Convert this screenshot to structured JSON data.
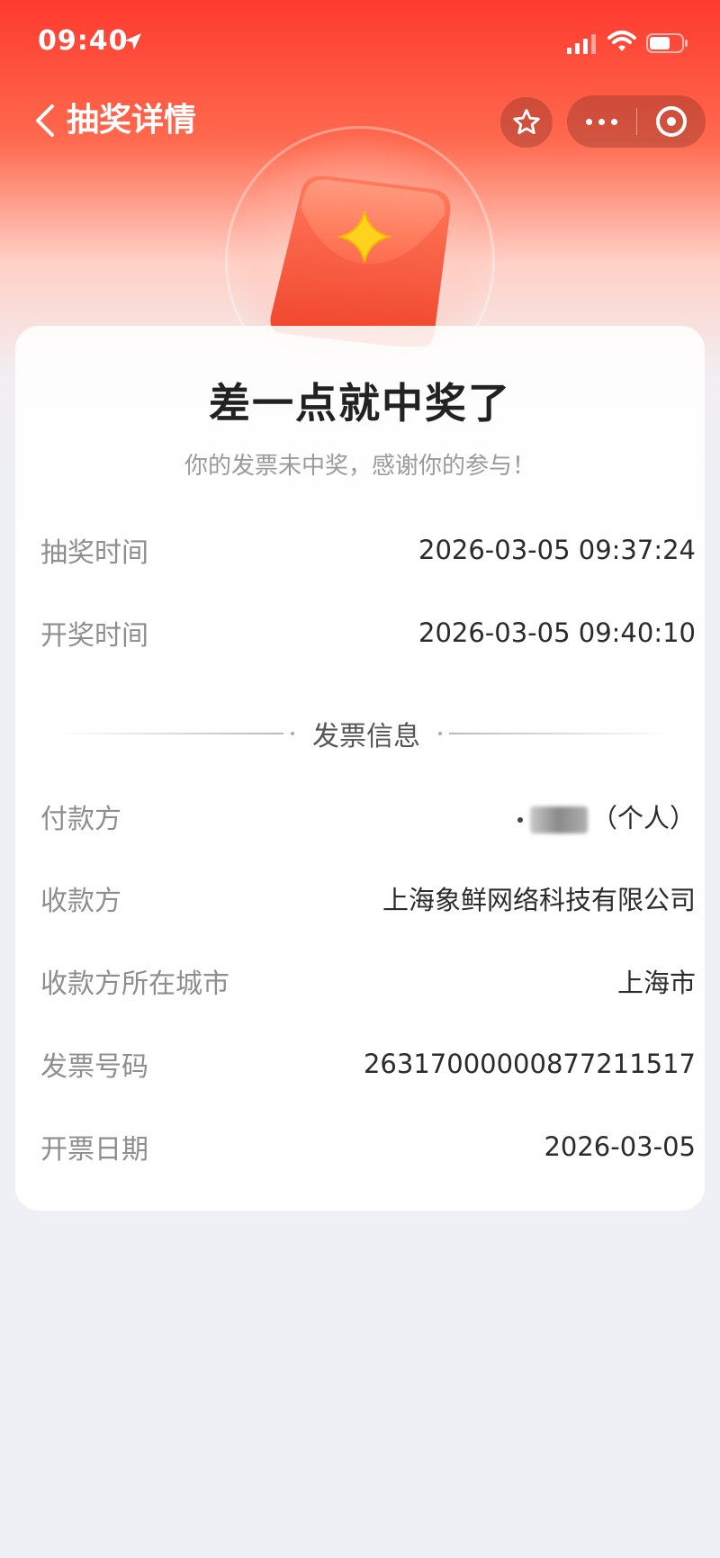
{
  "status_bar": {
    "time": "09:40"
  },
  "nav": {
    "title": "抽奖详情"
  },
  "result": {
    "title": "差一点就中奖了",
    "subtitle": "你的发票未中奖，感谢你的参与！"
  },
  "draw_info": [
    {
      "label": "抽奖时间",
      "value": "2026-03-05 09:37:24"
    },
    {
      "label": "开奖时间",
      "value": "2026-03-05 09:40:10"
    }
  ],
  "invoice_section": {
    "title": "发票信息"
  },
  "invoice_info": [
    {
      "label": "付款方",
      "value": "（个人）"
    },
    {
      "label": "收款方",
      "value": "上海象鲜网络科技有限公司"
    },
    {
      "label": "收款方所在城市",
      "value": "上海市"
    },
    {
      "label": "发票号码",
      "value": "26317000000877211517"
    },
    {
      "label": "开票日期",
      "value": "2026-03-05"
    }
  ],
  "colors": {
    "header_red": "#ff3a2e",
    "page_bg": "#eef0f6",
    "star_yellow": "#ffd21f"
  },
  "icons": [
    "location-arrow-icon",
    "signal-icon",
    "wifi-icon",
    "battery-icon",
    "back-chevron-icon",
    "star-outline-icon",
    "more-dots-icon",
    "target-close-icon",
    "red-packet-illustration"
  ]
}
